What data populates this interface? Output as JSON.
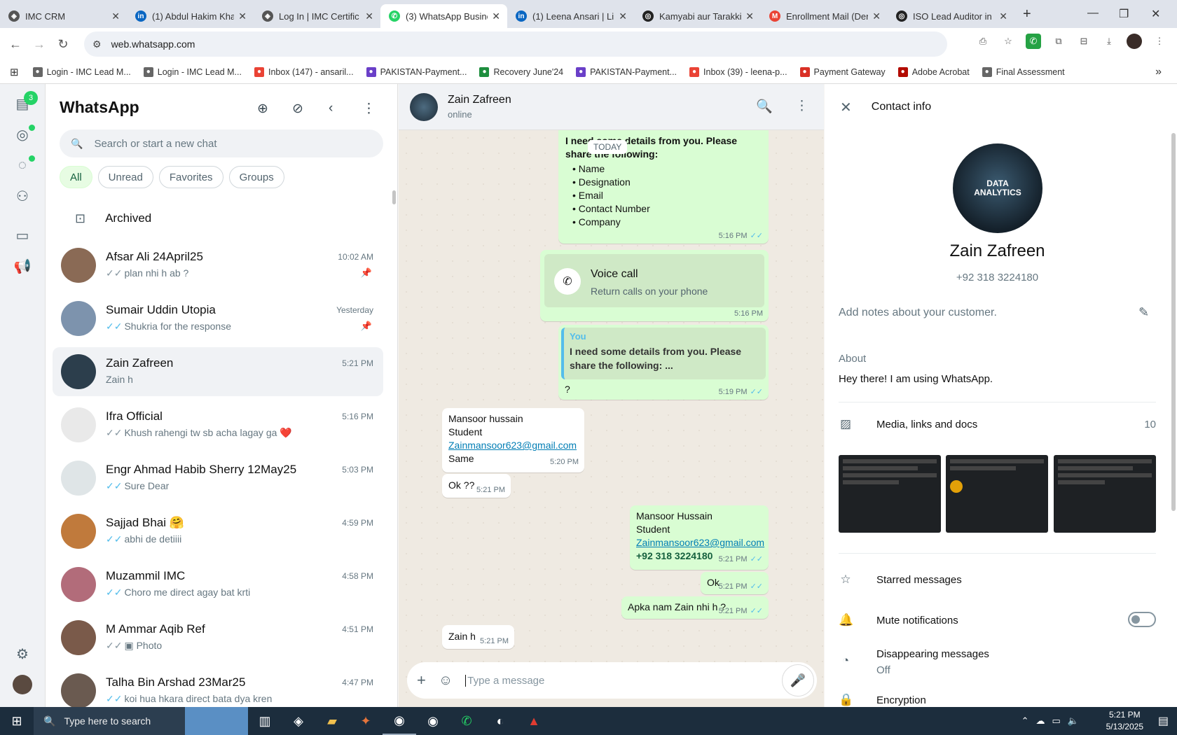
{
  "browser": {
    "tabs": [
      {
        "title": "IMC CRM",
        "icon": "crm",
        "active": false
      },
      {
        "title": "(1) Abdul Hakim Kha",
        "icon": "in",
        "active": false
      },
      {
        "title": "Log In | IMC Certific",
        "icon": "crm",
        "active": false
      },
      {
        "title": "(3) WhatsApp Busine",
        "icon": "wa",
        "active": true
      },
      {
        "title": "(1) Leena Ansari | Lin",
        "icon": "in",
        "active": false
      },
      {
        "title": "Kamyabi aur Tarakki",
        "icon": "th",
        "active": false
      },
      {
        "title": "Enrollment Mail (Der",
        "icon": "gm",
        "active": false
      },
      {
        "title": "ISO Lead Auditor in",
        "icon": "th",
        "active": false
      }
    ],
    "url": "web.whatsapp.com",
    "bookmarks": [
      {
        "label": "Login - IMC Lead M..."
      },
      {
        "label": "Login - IMC Lead M..."
      },
      {
        "label": "Inbox (147) - ansaril..."
      },
      {
        "label": "PAKISTAN-Payment..."
      },
      {
        "label": "Recovery June'24"
      },
      {
        "label": "PAKISTAN-Payment..."
      },
      {
        "label": "Inbox (39) - leena-p..."
      },
      {
        "label": "Payment Gateway"
      },
      {
        "label": "Adobe Acrobat"
      },
      {
        "label": "Final Assessment"
      }
    ]
  },
  "rail": {
    "badge": "3"
  },
  "sidebar": {
    "title": "WhatsApp",
    "search_placeholder": "Search or start a new chat",
    "filters": [
      "All",
      "Unread",
      "Favorites",
      "Groups"
    ],
    "archived": "Archived",
    "chats": [
      {
        "name": "Afsar Ali 24April25",
        "msg": "plan nhi h ab ?",
        "time": "10:02 AM",
        "tick": "grey",
        "pinned": true,
        "color": "#8a6a55"
      },
      {
        "name": "Sumair Uddin Utopia",
        "msg": "Shukria for the response",
        "time": "Yesterday",
        "tick": "blue",
        "pinned": true,
        "color": "#7d93ad"
      },
      {
        "name": "Zain Zafreen",
        "msg": "Zain h",
        "time": "5:21 PM",
        "tick": "",
        "pinned": false,
        "color": "#2c3e4c"
      },
      {
        "name": "Ifra Official",
        "msg": "Khush rahengi tw sb acha lagay ga ❤️",
        "time": "5:16 PM",
        "tick": "grey",
        "pinned": false,
        "color": "#e9e9e9"
      },
      {
        "name": "Engr Ahmad Habib Sherry 12May25",
        "msg": "Sure Dear",
        "time": "5:03 PM",
        "tick": "blue",
        "pinned": false,
        "color": "#dfe5e7"
      },
      {
        "name": "Sajjad Bhai 🤗",
        "msg": "abhi de detiiii",
        "time": "4:59 PM",
        "tick": "blue",
        "pinned": false,
        "color": "#c07a3c"
      },
      {
        "name": "Muzammil IMC",
        "msg": "Choro me direct agay bat krti",
        "time": "4:58 PM",
        "tick": "blue",
        "pinned": false,
        "color": "#b26c7a"
      },
      {
        "name": "M Ammar Aqib Ref",
        "msg": "▣ Photo",
        "time": "4:51 PM",
        "tick": "grey",
        "pinned": false,
        "color": "#7a5a4a"
      },
      {
        "name": "Talha Bin Arshad 23Mar25",
        "msg": "koi hua hkara direct bata dya kren",
        "time": "4:47 PM",
        "tick": "blue",
        "pinned": false,
        "color": "#6a5a50"
      }
    ]
  },
  "conversation": {
    "name": "Zain Zafreen",
    "status": "online",
    "today": "TODAY",
    "msg1_title": "I need some details from you. Please share the following:",
    "msg1_items": [
      "Name",
      "Designation",
      "Email",
      "Contact Number",
      "Company"
    ],
    "msg1_time": "5:16 PM",
    "call_title": "Voice call",
    "call_sub": "Return calls on your phone",
    "call_time": "5:16 PM",
    "quote_author": "You",
    "quote_text": "I need some details from you. Please share the following:  ...",
    "reply_text": "?",
    "reply_time": "5:19 PM",
    "in1_l1": "Mansoor hussain",
    "in1_l2": "Student",
    "in1_link": "Zainmansoor623@gmail.com",
    "in1_l3": "Same",
    "in1_time": "5:20 PM",
    "in2_text": "Ok ??",
    "in2_time": "5:21 PM",
    "out2_l1": "Mansoor Hussain",
    "out2_l2": "Student",
    "out2_link": "Zainmansoor623@gmail.com",
    "out2_phone": "+92 318 3224180",
    "out2_time": "5:21 PM",
    "out3_text": "Ok",
    "out3_time": "5:21 PM",
    "out4_text": "Apka nam Zain nhi h ?",
    "out4_time": "5:21 PM",
    "in3_text": "Zain h",
    "in3_time": "5:21 PM",
    "composer_placeholder": "Type a message"
  },
  "contact": {
    "header": "Contact info",
    "avatar_text": "DATA ANALYTICS",
    "name": "Zain Zafreen",
    "phone": "+92 318 3224180",
    "notes_placeholder": "Add notes about your customer.",
    "about_label": "About",
    "about_text": "Hey there! I am using WhatsApp.",
    "media_label": "Media, links and docs",
    "media_count": "10",
    "starred": "Starred messages",
    "mute": "Mute notifications",
    "disappearing": "Disappearing messages",
    "disappearing_value": "Off",
    "encryption": "Encryption"
  },
  "taskbar": {
    "search": "Type here to search",
    "time": "5:21 PM",
    "date": "5/13/2025"
  }
}
